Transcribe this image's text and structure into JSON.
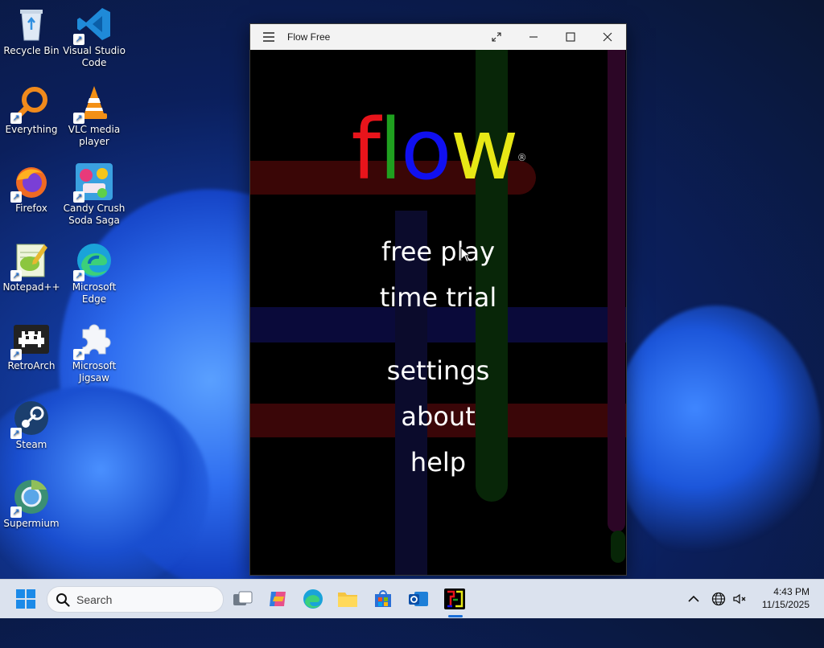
{
  "desktop": {
    "icons": [
      {
        "label": "Recycle Bin"
      },
      {
        "label": "Visual Studio Code"
      },
      {
        "label": "Everything"
      },
      {
        "label": "VLC media player"
      },
      {
        "label": "Firefox"
      },
      {
        "label": "Candy Crush Soda Saga"
      },
      {
        "label": "Notepad++"
      },
      {
        "label": "Microsoft Edge"
      },
      {
        "label": "RetroArch"
      },
      {
        "label": "Microsoft Jigsaw"
      },
      {
        "label": "Steam"
      },
      {
        "label": "Supermium"
      }
    ]
  },
  "window": {
    "title": "Flow Free",
    "logo": {
      "letters": [
        "f",
        "l",
        "o",
        "w"
      ],
      "colors": [
        "#e8141b",
        "#1fa01f",
        "#1010f0",
        "#e8e816"
      ],
      "mark": "®"
    },
    "menu": [
      "free play",
      "time trial",
      "settings",
      "about",
      "help"
    ]
  },
  "taskbar": {
    "search_placeholder": "Search",
    "time": "4:43 PM",
    "date": "11/15/2025"
  },
  "colors": {
    "taskbar_bg": "#dbe2ee",
    "accent": "#1b6fd8"
  }
}
